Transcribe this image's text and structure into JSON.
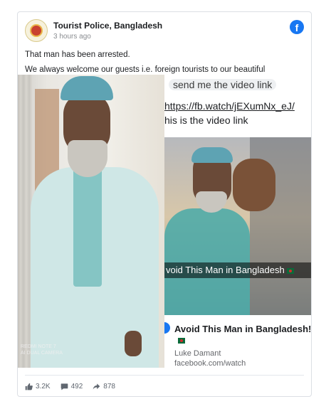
{
  "post": {
    "page_name": "Tourist Police, Bangladesh",
    "time": "3 hours ago",
    "lines": [
      "That man has been arrested.",
      "We always welcome our guests i.e. foreign tourists to our beautiful Bangladesh."
    ]
  },
  "photo_left": {
    "watermark_line1": "REDMI NOTE 7",
    "watermark_line2": "AI DUAL CAMERA"
  },
  "screenshot_right": {
    "chat_line1": "send me the video link",
    "chat_line2": "https://fb.watch/jEXumNx_eJ/",
    "chat_line3": "his is the video link",
    "video_caption": "void This Man in Bangladesh",
    "link_title": "Avoid This Man in Bangladesh!",
    "link_author": "Luke Damant",
    "link_url": "facebook.com/watch"
  },
  "footer": {
    "likes": "3.2K",
    "comments": "492",
    "shares": "878"
  },
  "colors": {
    "facebook_blue": "#1877f2",
    "text": "#1c1e21",
    "muted": "#65676b"
  }
}
